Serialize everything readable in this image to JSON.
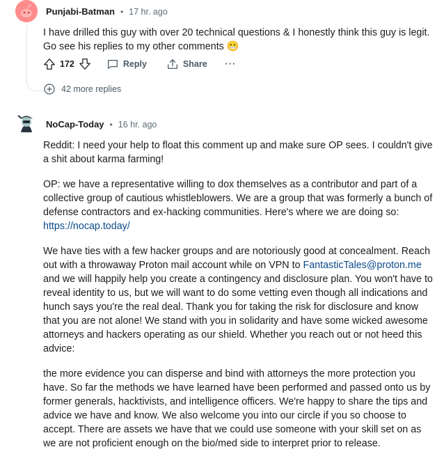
{
  "comment1": {
    "username": "Punjabi-Batman",
    "dot": "•",
    "time": "17 hr. ago",
    "text": "I have drilled this guy with over 20 technical questions & I honestly think this guy is legit. Go see his replies to my other comments",
    "emoji": "😬",
    "votes": "172",
    "reply_label": "Reply",
    "share_label": "Share",
    "more_label": "···",
    "more_replies": "42 more replies"
  },
  "comment2": {
    "username": "NoCap-Today",
    "dot": "•",
    "time": "16 hr. ago",
    "p1": "Reddit: I need your help to float this comment up and make sure OP sees. I couldn't give a shit about karma farming!",
    "p2_text": "OP: we have a representative willing to dox themselves as a contributor and part of a collective group of cautious whistleblowers. We are a group that was formerly a bunch of defense contractors and ex-hacking communities. Here's where we are doing so: ",
    "p2_link": "https://nocap.today/",
    "p3_before": "We have ties with a few hacker groups and are notoriously good at concealment. Reach out with a throwaway Proton mail account while on VPN to ",
    "p3_link": "FantasticTales@proton.me",
    "p3_after": " and we will happily help you create a contingency and disclosure plan. You won't have to reveal identity to us, but we will want to do some vetting even though all indications and hunch says you're the real deal. Thank you for taking the risk for disclosure and know that you are not alone! We stand with you in solidarity and have some wicked awesome attorneys and hackers operating as our shield. Whether you reach out or not heed this advice:",
    "p4": "the more evidence you can disperse and bind with attorneys the more protection you have. So far the methods we have learned have been performed and passed onto us by former generals, hacktivists, and intelligence officers. We're happy to share the tips and advice we have and know. We also welcome you into our circle if you so choose to accept. There are assets we have that we could use someone with your skill set on as we are not proficient enough on the bio/med side to interpret prior to release."
  }
}
